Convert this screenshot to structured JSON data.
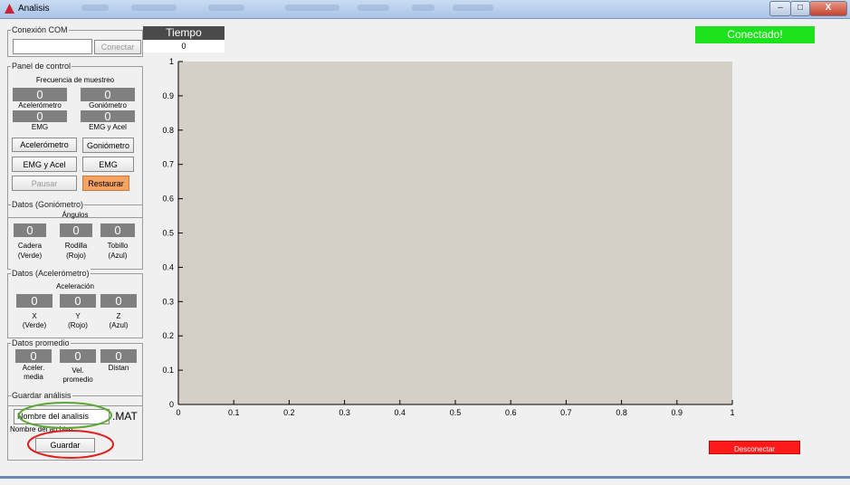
{
  "window": {
    "title": "Analisis",
    "controls": [
      "–",
      "□",
      "X"
    ]
  },
  "status": {
    "label": "Conectado!",
    "color": "#1ce21c"
  },
  "tiempo": {
    "header": "Tiempo",
    "value": "0"
  },
  "conexion": {
    "title": "Conexión COM",
    "port_value": "",
    "connect_button": "Conectar"
  },
  "control_panel": {
    "title": "Panel de control",
    "subtitle": "Frecuencia de muestreo",
    "displays": [
      {
        "value": "0",
        "label": "Acelerómetro"
      },
      {
        "value": "0",
        "label": "Goniómetro"
      },
      {
        "value": "0",
        "label": "EMG"
      },
      {
        "value": "0",
        "label": "EMG y Acel"
      }
    ],
    "buttons": {
      "acelerometro": "Acelerómetro",
      "goniometro": "Goniómetro",
      "emg_acel": "EMG y Acel",
      "emg": "EMG",
      "pausar": "Pausar",
      "restaurar": "Restaurar"
    }
  },
  "goniometro": {
    "title": "Datos (Goniómetro)",
    "subtitle": "Ángulos",
    "items": [
      {
        "value": "0",
        "label1": "Cadera",
        "label2": "(Verde)"
      },
      {
        "value": "0",
        "label1": "Rodilla",
        "label2": "(Rojo)"
      },
      {
        "value": "0",
        "label1": "Tobillo",
        "label2": "(Azul)"
      }
    ]
  },
  "acelerometro": {
    "title": "Datos (Acelerómetro)",
    "subtitle": "Aceleración",
    "items": [
      {
        "value": "0",
        "label1": "X",
        "label2": "(Verde)"
      },
      {
        "value": "0",
        "label1": "Y",
        "label2": "(Rojo)"
      },
      {
        "value": "0",
        "label1": "Z",
        "label2": "(Azul)"
      }
    ]
  },
  "promedio": {
    "title": "Datos promedio",
    "items": [
      {
        "value": "0",
        "label1": "Aceler.",
        "label2": "media"
      },
      {
        "value": "0",
        "label1": "Vel.",
        "label2": "promedio"
      },
      {
        "value": "0",
        "label1": "Distan",
        "label2": ""
      }
    ]
  },
  "guardar": {
    "title": "Guardar análisis",
    "filename": "Nombre del analisis",
    "extension": ".MAT",
    "helper": "Nombre del archivo",
    "button": "Guardar"
  },
  "disconnect_button": "Desconectar",
  "chart_data": {
    "type": "line",
    "series": [],
    "xlim": [
      0,
      1
    ],
    "ylim": [
      0,
      1
    ],
    "xticks": [
      "0",
      "0.1",
      "0.2",
      "0.3",
      "0.4",
      "0.5",
      "0.6",
      "0.7",
      "0.8",
      "0.9",
      "1"
    ],
    "yticks": [
      "0",
      "0.1",
      "0.2",
      "0.3",
      "0.4",
      "0.5",
      "0.6",
      "0.7",
      "0.8",
      "0.9",
      "1"
    ],
    "title": "",
    "xlabel": "",
    "ylabel": "",
    "background": "#d4d0c8"
  },
  "colors": {
    "annotation_green": "#5aa832",
    "annotation_red": "#e02020"
  }
}
